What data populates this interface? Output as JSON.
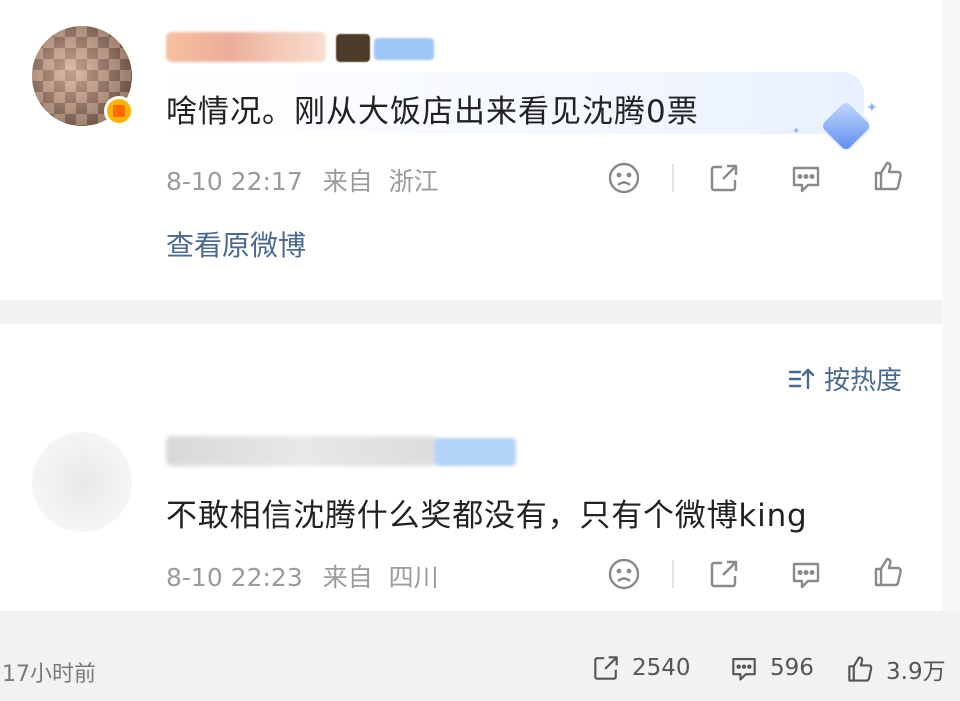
{
  "comments": [
    {
      "text": "啥情况。刚从大饭店出来看见沈腾0票",
      "time": "8-10 22:17",
      "location_prefix": "来自",
      "location": "浙江",
      "view_original": "查看原微博"
    },
    {
      "text": "不敢相信沈腾什么奖都没有，只有个微博king",
      "time": "8-10 22:23",
      "location_prefix": "来自",
      "location": "四川"
    }
  ],
  "sort": {
    "label": "按热度"
  },
  "footer": {
    "time": "17小时前",
    "reposts": "2540",
    "comments": "596",
    "likes": "3.9万"
  },
  "icons": {
    "dislike": "sad-face-icon",
    "share": "share-icon",
    "comment": "comment-icon",
    "like": "thumbs-up-icon",
    "sort": "sort-icon"
  },
  "colors": {
    "link": "#4a6a92",
    "meta": "#9b9b9b",
    "icon": "#8a8a8a"
  }
}
